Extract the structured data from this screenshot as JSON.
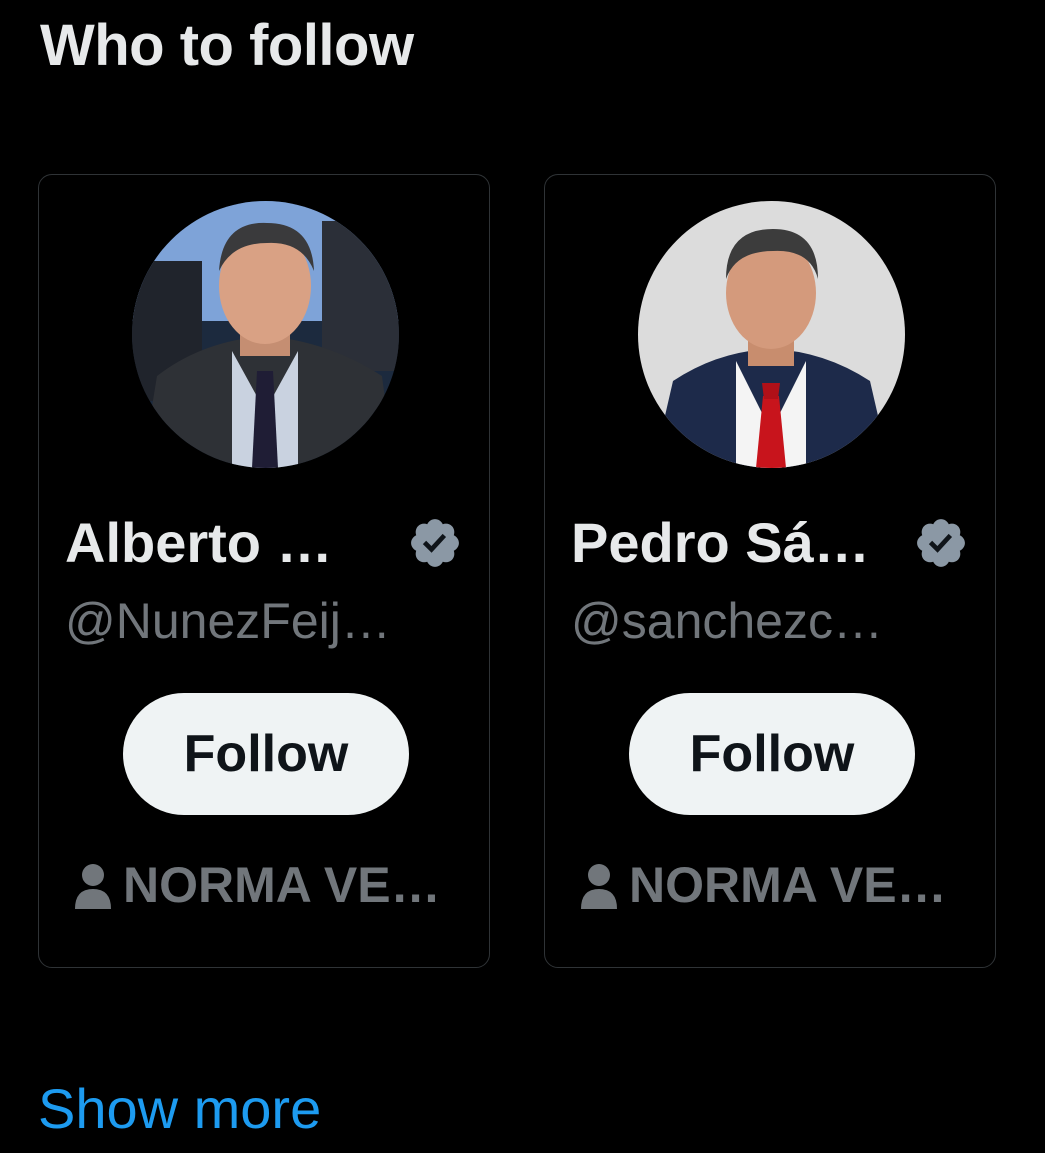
{
  "section": {
    "title": "Who to follow",
    "show_more_label": "Show more"
  },
  "colors": {
    "background": "#000000",
    "card_border": "#2f3336",
    "primary_text": "#e7e9ea",
    "secondary_text": "#71767b",
    "follow_button_bg": "#eff3f4",
    "follow_button_text": "#0f1419",
    "verified_badge": "#8b98a5",
    "link": "#1d9bf0"
  },
  "suggestions": [
    {
      "display_name": "Alberto …",
      "handle": "@NunezFeij…",
      "verified": true,
      "follow_label": "Follow",
      "followed_by": "NORMA VE…",
      "avatar_icon": "profile-photo"
    },
    {
      "display_name": "Pedro Sá…",
      "handle": "@sanchezc…",
      "verified": true,
      "follow_label": "Follow",
      "followed_by": "NORMA VE…",
      "avatar_icon": "profile-photo"
    }
  ]
}
